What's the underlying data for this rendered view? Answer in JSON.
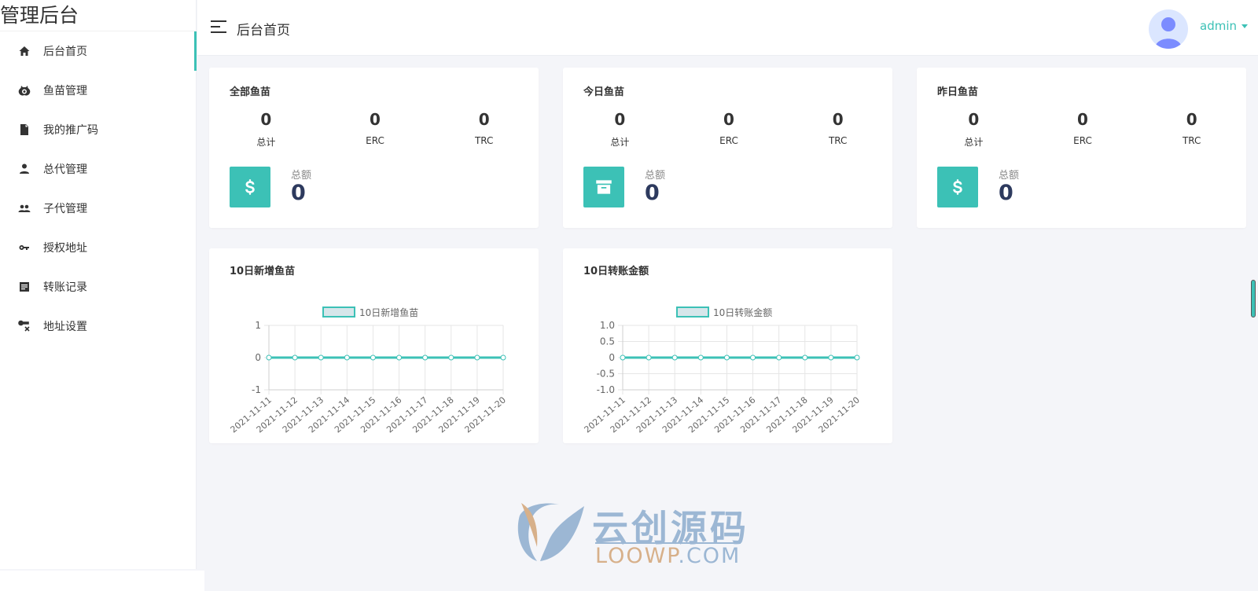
{
  "brand": {
    "title": "管理后台"
  },
  "sidebar": {
    "items": [
      {
        "label": "后台首页",
        "icon": "home-icon",
        "active": true
      },
      {
        "label": "鱼苗管理",
        "icon": "fish-icon",
        "active": false
      },
      {
        "label": "我的推广码",
        "icon": "document-icon",
        "active": false
      },
      {
        "label": "总代管理",
        "icon": "person-icon",
        "active": false
      },
      {
        "label": "子代管理",
        "icon": "people-icon",
        "active": false
      },
      {
        "label": "授权地址",
        "icon": "key-icon",
        "active": false
      },
      {
        "label": "转账记录",
        "icon": "receipt-icon",
        "active": false
      },
      {
        "label": "地址设置",
        "icon": "address-settings-icon",
        "active": false
      }
    ]
  },
  "header": {
    "title": "后台首页",
    "user": "admin"
  },
  "colors": {
    "accent": "#3cc1b6",
    "total_value": "#2d3a5e"
  },
  "stats": [
    {
      "title": "全部鱼苗",
      "total": "0",
      "erc": "0",
      "trc": "0",
      "labels": [
        "总计",
        "ERC",
        "TRC"
      ],
      "sum_label": "总额",
      "sum_value": "0",
      "icon": "dollar-icon"
    },
    {
      "title": "今日鱼苗",
      "total": "0",
      "erc": "0",
      "trc": "0",
      "labels": [
        "总计",
        "ERC",
        "TRC"
      ],
      "sum_label": "总额",
      "sum_value": "0",
      "icon": "archive-icon"
    },
    {
      "title": "昨日鱼苗",
      "total": "0",
      "erc": "0",
      "trc": "0",
      "labels": [
        "总计",
        "ERC",
        "TRC"
      ],
      "sum_label": "总额",
      "sum_value": "0",
      "icon": "dollar-icon"
    }
  ],
  "chart_titles": [
    "10日新增鱼苗",
    "10日转账金额"
  ],
  "watermark": {
    "text": "云创源码",
    "url_a": "LOOWP",
    "url_dot": ".",
    "url_b": "COM"
  },
  "chart_data": [
    {
      "type": "line",
      "title": "10日新增鱼苗",
      "x": [
        "2021-11-11",
        "2021-11-12",
        "2021-11-13",
        "2021-11-14",
        "2021-11-15",
        "2021-11-16",
        "2021-11-17",
        "2021-11-18",
        "2021-11-19",
        "2021-11-20"
      ],
      "series": [
        {
          "name": "10日新增鱼苗",
          "values": [
            0,
            0,
            0,
            0,
            0,
            0,
            0,
            0,
            0,
            0
          ]
        }
      ],
      "ylim": [
        -1,
        1
      ],
      "yticks": [
        "1",
        "0",
        "-1"
      ],
      "grid": true,
      "legend": "top-center"
    },
    {
      "type": "line",
      "title": "10日转账金额",
      "x": [
        "2021-11-11",
        "2021-11-12",
        "2021-11-13",
        "2021-11-14",
        "2021-11-15",
        "2021-11-16",
        "2021-11-17",
        "2021-11-18",
        "2021-11-19",
        "2021-11-20"
      ],
      "series": [
        {
          "name": "10日转账金额",
          "values": [
            0,
            0,
            0,
            0,
            0,
            0,
            0,
            0,
            0,
            0
          ]
        }
      ],
      "ylim": [
        -1,
        1
      ],
      "yticks": [
        "1.0",
        "0.5",
        "0",
        "-0.5",
        "-1.0"
      ],
      "grid": true,
      "legend": "top-center"
    }
  ]
}
